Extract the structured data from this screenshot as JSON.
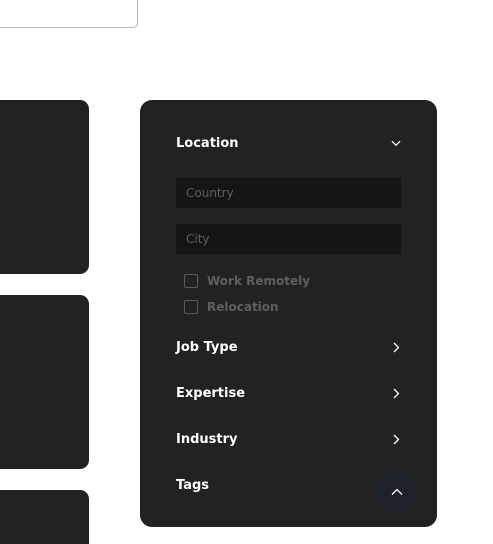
{
  "filters": {
    "location": {
      "label": "Location",
      "expanded": true,
      "country_placeholder": "Country",
      "city_placeholder": "City",
      "options": [
        {
          "label": "Work Remotely",
          "checked": false
        },
        {
          "label": "Relocation",
          "checked": false
        }
      ]
    },
    "job_type": {
      "label": "Job Type",
      "expanded": false
    },
    "expertise": {
      "label": "Expertise",
      "expanded": false
    },
    "industry": {
      "label": "Industry",
      "expanded": false
    },
    "tags": {
      "label": "Tags",
      "expanded": false
    }
  },
  "icons": {
    "location_toggle": "chevron-down-icon",
    "collapsed_toggle": "chevron-right-icon",
    "scroll_top": "chevron-up-icon"
  },
  "colors": {
    "panel_bg": "#222222",
    "input_bg": "#151515",
    "text_primary": "#ffffff",
    "text_muted": "#5f5f5f",
    "scroll_button_bg": "#1d2129"
  }
}
